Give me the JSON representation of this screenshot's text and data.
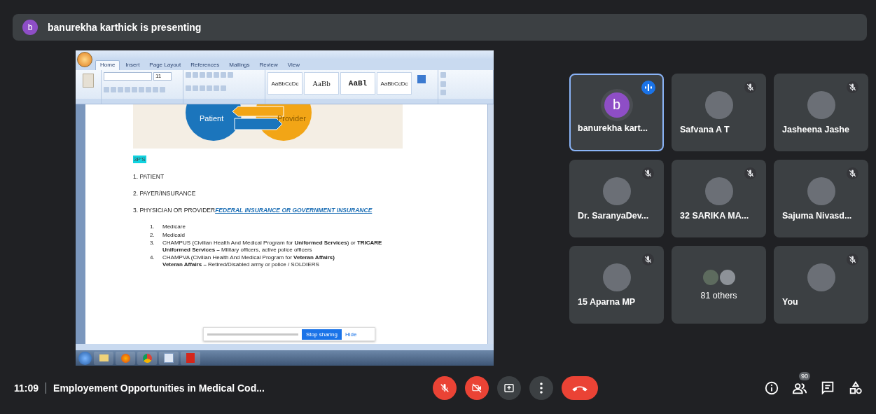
{
  "presenter_bar": {
    "avatar_letter": "b",
    "text": "banurekha karthick is presenting"
  },
  "shared_screen": {
    "ribbon_tabs": [
      {
        "label": "Home",
        "selected": true
      },
      {
        "label": "Insert",
        "selected": false
      },
      {
        "label": "Page Layout",
        "selected": false
      },
      {
        "label": "References",
        "selected": false
      },
      {
        "label": "Mailings",
        "selected": false
      },
      {
        "label": "Review",
        "selected": false
      },
      {
        "label": "View",
        "selected": false
      }
    ],
    "font_size": "11",
    "styles": [
      {
        "sample": "AaBbCcDc"
      },
      {
        "sample": "AaBb"
      },
      {
        "sample": "AaBl"
      },
      {
        "sample": "AaBbCcDc"
      }
    ],
    "diagram": {
      "left": "Patient",
      "right": "Provider"
    },
    "heading": "3P'S",
    "items": [
      "1. PATIENT",
      "2. PAYER/INSURANCE",
      "3. PHYSICIAN OR PROVIDER"
    ],
    "item_link": "FEDERAL INSURANCE OR GOVERNMENT INSURANCE",
    "sublist": [
      {
        "number": "1.",
        "text": "Medicare"
      },
      {
        "number": "2.",
        "text": "Medicaid"
      },
      {
        "number": "3.",
        "text": "CHAMPUS (Civilian Health And Medical Program for **Uniformed Services**) or **TRICARE**",
        "detail": "**Uniformed Services –** Military officers, active police officers"
      },
      {
        "number": "4.",
        "text": "CHAMPVA (Civilian Health And Medical Program for **Veteran Affairs)**",
        "detail": "**Veteran Affairs –** Retired/Disabled  army or police / SOLDIERS"
      }
    ],
    "sharing_bar": {
      "stop": "Stop sharing",
      "hide": "Hide"
    }
  },
  "participants": [
    {
      "kind": "letter",
      "letter": "b",
      "name": "banurekha kart...",
      "speaking": true,
      "muted": false
    },
    {
      "kind": "photo",
      "name": "Safvana A T",
      "speaking": false,
      "muted": true
    },
    {
      "kind": "photo",
      "name": "Jasheena Jashe",
      "speaking": false,
      "muted": true
    },
    {
      "kind": "photo",
      "name": "Dr. SaranyaDev...",
      "speaking": false,
      "muted": true
    },
    {
      "kind": "photo",
      "name": "32 SARIKA MA...",
      "speaking": false,
      "muted": true
    },
    {
      "kind": "photo",
      "name": "Sajuma Nivasd...",
      "speaking": false,
      "muted": true
    },
    {
      "kind": "photo",
      "name": "15 Aparna MP",
      "speaking": false,
      "muted": true
    },
    {
      "kind": "others",
      "name": "81 others",
      "speaking": false,
      "muted": false
    },
    {
      "kind": "photo",
      "name": "You",
      "speaking": false,
      "muted": true
    }
  ],
  "bottom_bar": {
    "time": "11:09",
    "meeting_title": "Employement Opportunities in Medical Cod...",
    "mic_on": false,
    "camera_on": false,
    "people_count": "90"
  }
}
